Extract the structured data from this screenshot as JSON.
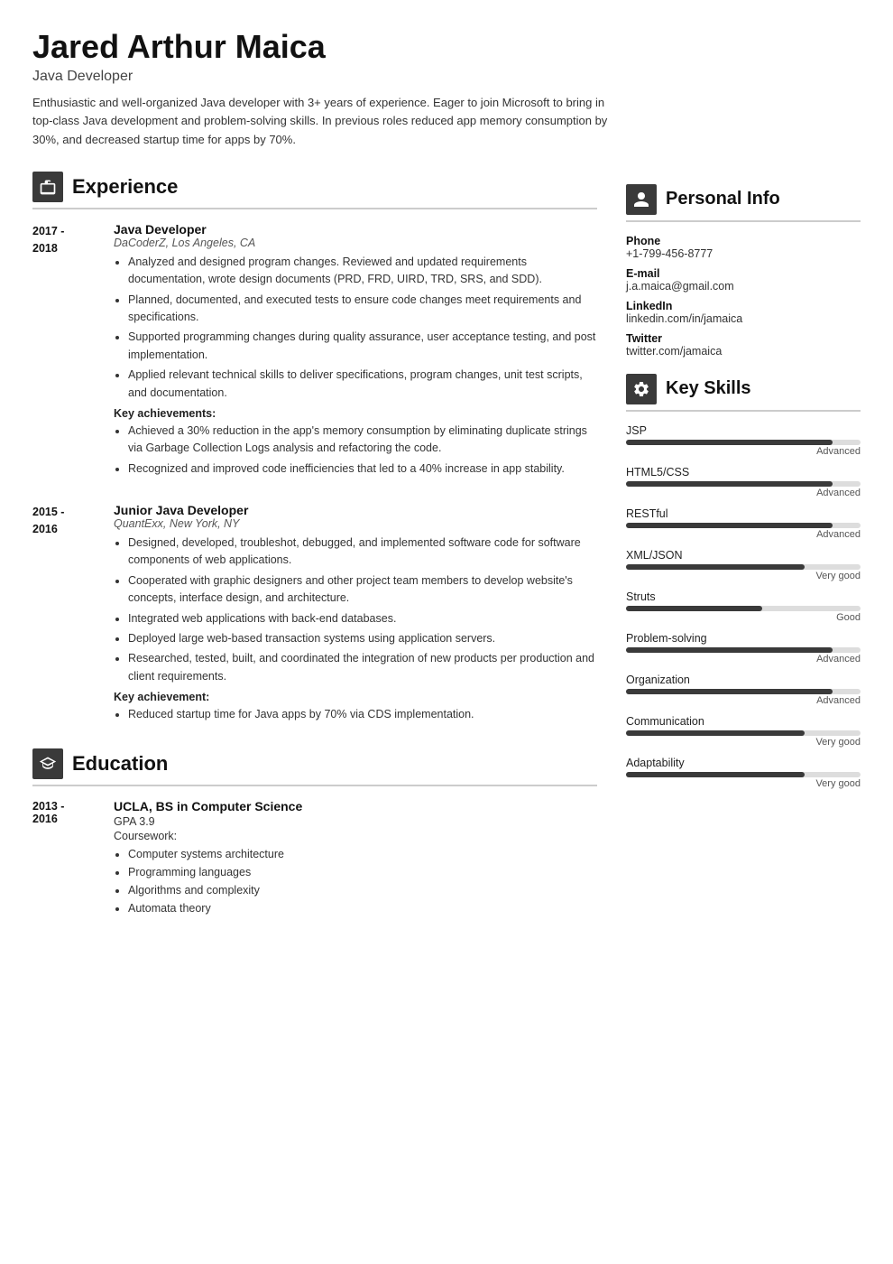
{
  "header": {
    "name": "Jared Arthur Maica",
    "title": "Java Developer",
    "summary": "Enthusiastic and well-organized Java developer with 3+ years of experience. Eager to join Microsoft to bring in top-class Java development and problem-solving skills. In previous roles reduced app memory consumption by 30%, and decreased startup time for apps by 70%."
  },
  "experience_section": {
    "label": "Experience",
    "jobs": [
      {
        "date": "2017 -\n2018",
        "title": "Java Developer",
        "company": "DaCoderZ, Los Angeles, CA",
        "bullets": [
          "Analyzed and designed program changes. Reviewed and updated requirements documentation, wrote design documents (PRD, FRD, UIRD, TRD, SRS, and SDD).",
          "Planned, documented, and executed tests to ensure code changes meet requirements and specifications.",
          "Supported programming changes during quality assurance, user acceptance testing, and post implementation.",
          "Applied relevant technical skills to deliver specifications, program changes, unit test scripts, and documentation."
        ],
        "achievements_label": "Key achievements:",
        "achievements": [
          "Achieved a 30% reduction in the app's memory consumption by eliminating duplicate strings via Garbage Collection Logs analysis and refactoring the code.",
          "Recognized and improved code inefficiencies that led to a 40% increase in app stability."
        ]
      },
      {
        "date": "2015 -\n2016",
        "title": "Junior Java Developer",
        "company": "QuantExx, New York, NY",
        "bullets": [
          "Designed, developed, troubleshot, debugged, and implemented software code for software components of web applications.",
          "Cooperated with graphic designers and other project team members to develop website's concepts, interface design, and architecture.",
          "Integrated web applications with back-end databases.",
          "Deployed large web-based transaction systems using application servers.",
          "Researched, tested, built, and coordinated the integration of new products per production and client requirements."
        ],
        "achievements_label": "Key achievement:",
        "achievements": [
          "Reduced startup time for Java apps by 70% via CDS implementation."
        ]
      }
    ]
  },
  "education_section": {
    "label": "Education",
    "entries": [
      {
        "date": "2013 -\n2016",
        "school": "UCLA, BS in Computer Science",
        "gpa": "GPA 3.9",
        "coursework_label": "Coursework:",
        "courses": [
          "Computer systems architecture",
          "Programming languages",
          "Algorithms and complexity",
          "Automata theory"
        ]
      }
    ]
  },
  "personal_info": {
    "label": "Personal Info",
    "items": [
      {
        "label": "Phone",
        "value": "+1-799-456-8777"
      },
      {
        "label": "E-mail",
        "value": "j.a.maica@gmail.com"
      },
      {
        "label": "LinkedIn",
        "value": "linkedin.com/in/jamaica"
      },
      {
        "label": "Twitter",
        "value": "twitter.com/jamaica"
      }
    ]
  },
  "key_skills": {
    "label": "Key Skills",
    "skills": [
      {
        "name": "JSP",
        "level": "Advanced",
        "pct": 88
      },
      {
        "name": "HTML5/CSS",
        "level": "Advanced",
        "pct": 88
      },
      {
        "name": "RESTful",
        "level": "Advanced",
        "pct": 88
      },
      {
        "name": "XML/JSON",
        "level": "Very good",
        "pct": 76
      },
      {
        "name": "Struts",
        "level": "Good",
        "pct": 58
      },
      {
        "name": "Problem-solving",
        "level": "Advanced",
        "pct": 88
      },
      {
        "name": "Organization",
        "level": "Advanced",
        "pct": 88
      },
      {
        "name": "Communication",
        "level": "Very good",
        "pct": 76
      },
      {
        "name": "Adaptability",
        "level": "Very good",
        "pct": 76
      }
    ]
  }
}
